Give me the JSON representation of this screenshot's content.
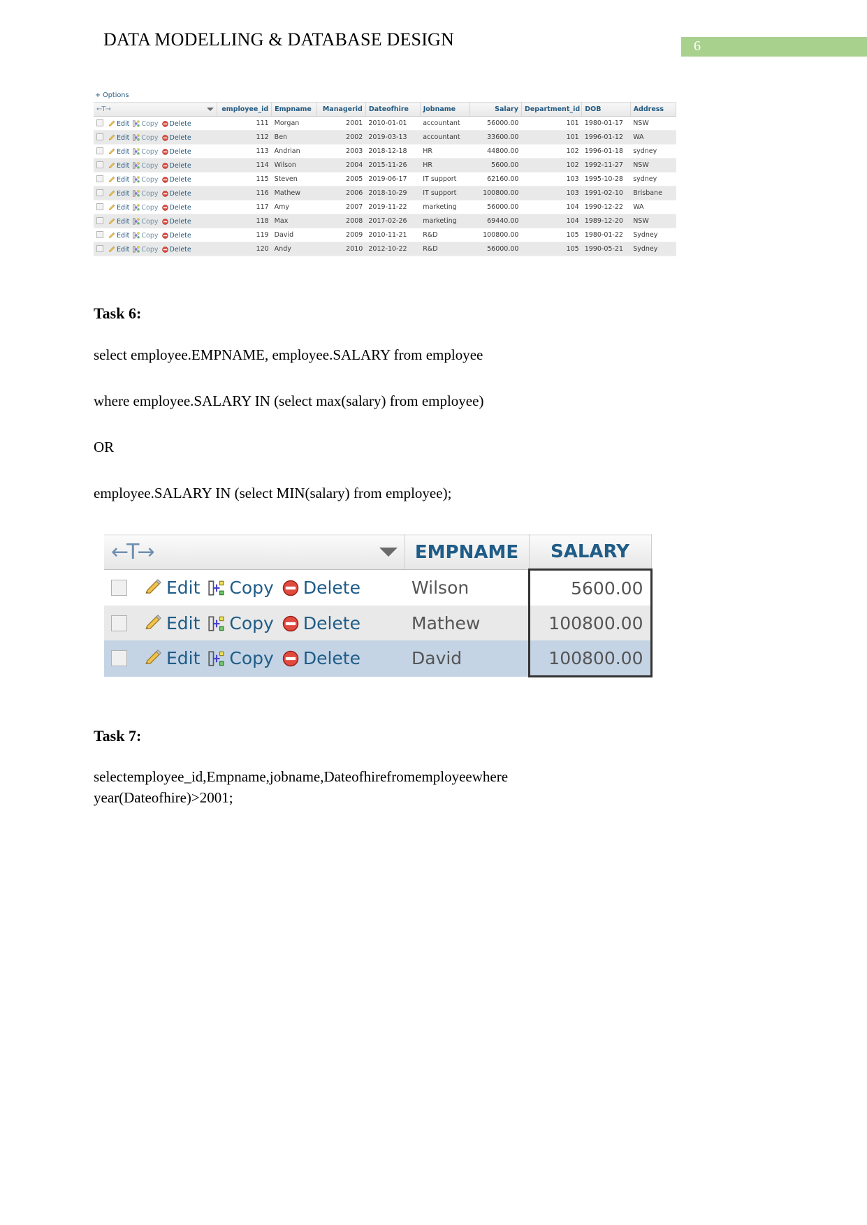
{
  "header": {
    "title": "DATA MODELLING & DATABASE DESIGN",
    "page_number": "6",
    "badge_color": "#a9d18e"
  },
  "result_table_1": {
    "options_label": "+ Options",
    "sort_control": "←T→",
    "action_labels": {
      "edit": "Edit",
      "copy": "Copy",
      "delete": "Delete"
    },
    "columns": [
      "employee_id",
      "Empname",
      "Managerid",
      "Dateofhire",
      "Jobname",
      "Salary",
      "Department_id",
      "DOB",
      "Address"
    ],
    "rows": [
      {
        "employee_id": "111",
        "Empname": "Morgan",
        "Managerid": "2001",
        "Dateofhire": "2010-01-01",
        "Jobname": "accountant",
        "Salary": "56000.00",
        "Department_id": "101",
        "DOB": "1980-01-17",
        "Address": "NSW"
      },
      {
        "employee_id": "112",
        "Empname": "Ben",
        "Managerid": "2002",
        "Dateofhire": "2019-03-13",
        "Jobname": "accountant",
        "Salary": "33600.00",
        "Department_id": "101",
        "DOB": "1996-01-12",
        "Address": "WA"
      },
      {
        "employee_id": "113",
        "Empname": "Andrian",
        "Managerid": "2003",
        "Dateofhire": "2018-12-18",
        "Jobname": "HR",
        "Salary": "44800.00",
        "Department_id": "102",
        "DOB": "1996-01-18",
        "Address": "sydney"
      },
      {
        "employee_id": "114",
        "Empname": "Wilson",
        "Managerid": "2004",
        "Dateofhire": "2015-11-26",
        "Jobname": "HR",
        "Salary": "5600.00",
        "Department_id": "102",
        "DOB": "1992-11-27",
        "Address": "NSW"
      },
      {
        "employee_id": "115",
        "Empname": "Steven",
        "Managerid": "2005",
        "Dateofhire": "2019-06-17",
        "Jobname": "IT support",
        "Salary": "62160.00",
        "Department_id": "103",
        "DOB": "1995-10-28",
        "Address": "sydney"
      },
      {
        "employee_id": "116",
        "Empname": "Mathew",
        "Managerid": "2006",
        "Dateofhire": "2018-10-29",
        "Jobname": "IT support",
        "Salary": "100800.00",
        "Department_id": "103",
        "DOB": "1991-02-10",
        "Address": "Brisbane"
      },
      {
        "employee_id": "117",
        "Empname": "Amy",
        "Managerid": "2007",
        "Dateofhire": "2019-11-22",
        "Jobname": "marketing",
        "Salary": "56000.00",
        "Department_id": "104",
        "DOB": "1990-12-22",
        "Address": "WA"
      },
      {
        "employee_id": "118",
        "Empname": "Max",
        "Managerid": "2008",
        "Dateofhire": "2017-02-26",
        "Jobname": "marketing",
        "Salary": "69440.00",
        "Department_id": "104",
        "DOB": "1989-12-20",
        "Address": "NSW"
      },
      {
        "employee_id": "119",
        "Empname": "David",
        "Managerid": "2009",
        "Dateofhire": "2010-11-21",
        "Jobname": "R&D",
        "Salary": "100800.00",
        "Department_id": "105",
        "DOB": "1980-01-22",
        "Address": "Sydney"
      },
      {
        "employee_id": "120",
        "Empname": "Andy",
        "Managerid": "2010",
        "Dateofhire": "2012-10-22",
        "Jobname": "R&D",
        "Salary": "56000.00",
        "Department_id": "105",
        "DOB": "1990-05-21",
        "Address": "Sydney"
      }
    ]
  },
  "task6": {
    "heading": "Task 6:",
    "query_line1": "select employee.EMPNAME, employee.SALARY from employee",
    "query_line2": "where employee.SALARY IN (select max(salary) from employee)",
    "query_line3": "OR",
    "query_line4": "employee.SALARY IN (select MIN(salary) from employee);"
  },
  "result_table_2": {
    "sort_control": "←T→",
    "action_labels": {
      "edit": "Edit",
      "copy": "Copy",
      "delete": "Delete"
    },
    "columns": [
      "EMPNAME",
      "SALARY"
    ],
    "rows": [
      {
        "EMPNAME": "Wilson",
        "SALARY": "5600.00"
      },
      {
        "EMPNAME": "Mathew",
        "SALARY": "100800.00"
      },
      {
        "EMPNAME": "David",
        "SALARY": "100800.00"
      }
    ]
  },
  "task7": {
    "heading": "Task 7:",
    "query_words": [
      "select",
      "employee_id,Empname,",
      "jobname,",
      "Dateofhire",
      "from",
      "employee",
      "where"
    ],
    "query_line2": "year(Dateofhire)>2001;"
  }
}
